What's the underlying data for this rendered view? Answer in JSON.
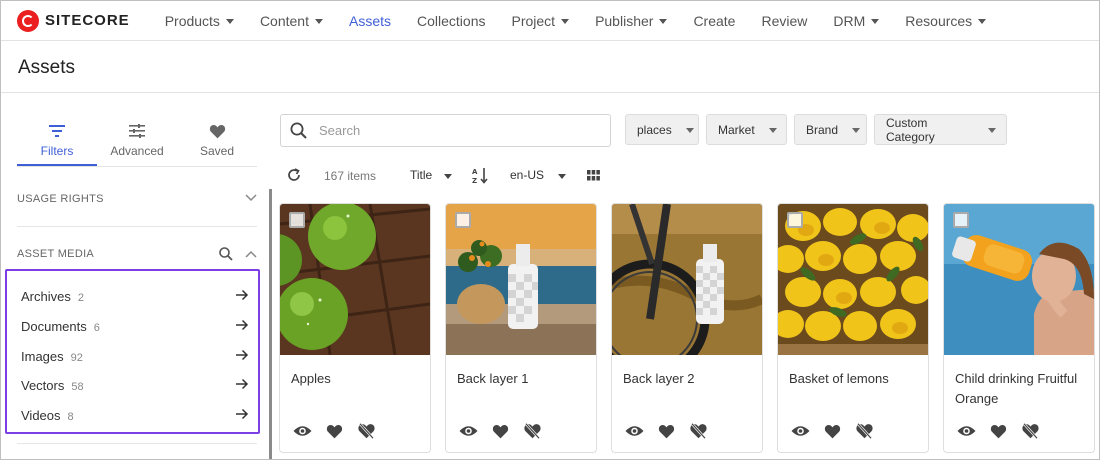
{
  "brand": {
    "name": "SITECORE"
  },
  "nav": [
    {
      "label": "Products",
      "dropdown": true
    },
    {
      "label": "Content",
      "dropdown": true
    },
    {
      "label": "Assets",
      "dropdown": false,
      "active": true
    },
    {
      "label": "Collections",
      "dropdown": false
    },
    {
      "label": "Project",
      "dropdown": true
    },
    {
      "label": "Publisher",
      "dropdown": true
    },
    {
      "label": "Create",
      "dropdown": false
    },
    {
      "label": "Review",
      "dropdown": false
    },
    {
      "label": "DRM",
      "dropdown": true
    },
    {
      "label": "Resources",
      "dropdown": true
    }
  ],
  "page": {
    "title": "Assets"
  },
  "sidebar": {
    "tabs": [
      {
        "label": "Filters",
        "icon": "filter-icon",
        "active": true
      },
      {
        "label": "Advanced",
        "icon": "sliders-icon"
      },
      {
        "label": "Saved",
        "icon": "heart-icon"
      }
    ],
    "usage_rights": "USAGE RIGHTS",
    "asset_media": "ASSET MEDIA",
    "media": [
      {
        "label": "Archives",
        "count": "2"
      },
      {
        "label": "Documents",
        "count": "6"
      },
      {
        "label": "Images",
        "count": "92"
      },
      {
        "label": "Vectors",
        "count": "58"
      },
      {
        "label": "Videos",
        "count": "8"
      }
    ]
  },
  "search": {
    "placeholder": "Search",
    "value": ""
  },
  "filters": [
    {
      "label": "places"
    },
    {
      "label": "Market"
    },
    {
      "label": "Brand"
    },
    {
      "label": "Custom Category"
    }
  ],
  "results": {
    "count": "167 items",
    "sort": "Title",
    "locale": "en-US"
  },
  "cards": [
    {
      "title": "Apples",
      "image": "apples"
    },
    {
      "title": "Back layer 1",
      "image": "plant-bottle"
    },
    {
      "title": "Back layer 2",
      "image": "bike-bottle"
    },
    {
      "title": "Basket of lemons",
      "image": "lemons"
    },
    {
      "title": "Child drinking Fruitful Orange",
      "image": "child-drinking"
    }
  ],
  "colors": {
    "accent": "#3f5fd6",
    "brand_red": "#eb1f1f",
    "highlight": "#7b3fe4",
    "text": "#333333"
  }
}
